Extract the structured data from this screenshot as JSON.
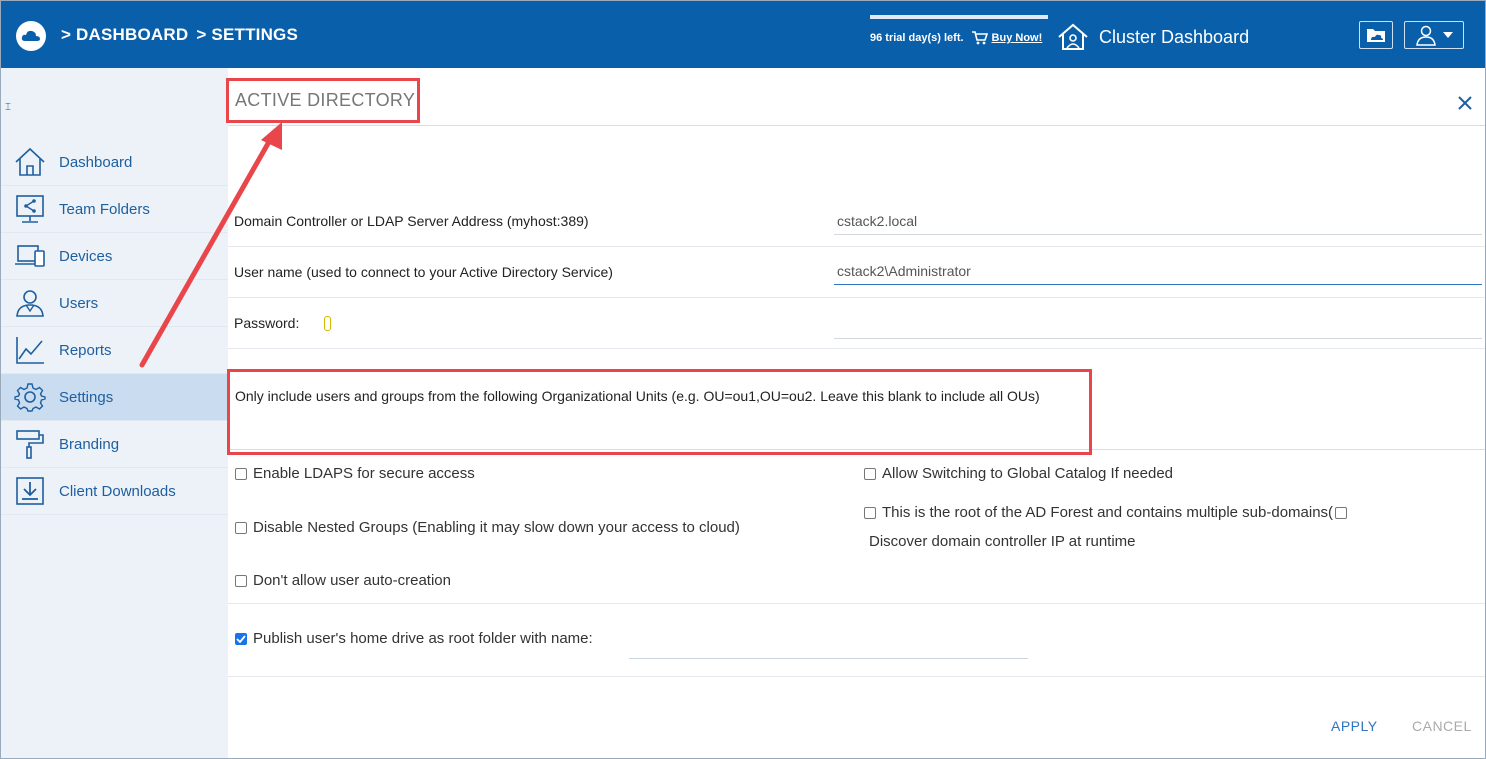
{
  "header": {
    "breadcrumbs": [
      "> DASHBOARD",
      "> SETTINGS"
    ],
    "trial_text": "96 trial day(s) left.",
    "buy_label": "Buy Now!",
    "cluster_label": "Cluster Dashboard",
    "icons": [
      "cloud-logo-icon",
      "cart-icon",
      "cluster-home-icon",
      "folder-icon",
      "user-icon",
      "caret-down-icon"
    ]
  },
  "sidebar": {
    "collapse_glyph": "⌶",
    "items": [
      {
        "label": "Dashboard",
        "icon": "home-icon",
        "active": false
      },
      {
        "label": "Team Folders",
        "icon": "team-folder-icon",
        "active": false
      },
      {
        "label": "Devices",
        "icon": "devices-icon",
        "active": false
      },
      {
        "label": "Users",
        "icon": "users-icon",
        "active": false
      },
      {
        "label": "Reports",
        "icon": "reports-icon",
        "active": false
      },
      {
        "label": "Settings",
        "icon": "gear-icon",
        "active": true
      },
      {
        "label": "Branding",
        "icon": "paint-roller-icon",
        "active": false
      },
      {
        "label": "Client Downloads",
        "icon": "download-icon",
        "active": false
      }
    ]
  },
  "panel": {
    "title": "ACTIVE DIRECTORY",
    "fields": {
      "server_label": "Domain Controller or LDAP Server Address (myhost:389)",
      "server_value": "cstack2.local",
      "username_label": "User name (used to connect to your Active Directory Service)",
      "username_value": "cstack2\\Administrator",
      "password_label": "Password:",
      "password_value": "",
      "ou_label": "Only include users and groups from the following Organizational Units (e.g. OU=ou1,OU=ou2. Leave this blank to include all OUs)"
    },
    "options": {
      "ldaps": {
        "label": "Enable LDAPS for secure access",
        "checked": false
      },
      "global_catalog": {
        "label": "Allow Switching to Global Catalog If needed",
        "checked": false
      },
      "nested_groups": {
        "label": "Disable Nested Groups (Enabling it may slow down your access to cloud)",
        "checked": false
      },
      "ad_forest": {
        "label": "This is the root of the AD Forest and contains multiple sub-domains(",
        "checked": false
      },
      "discover_dc": {
        "label": "Discover domain controller IP at runtime",
        "checked": false
      },
      "auto_create": {
        "label": "Don't allow user auto-creation",
        "checked": false
      },
      "home_drive": {
        "label": "Publish user's home drive as root folder with name:",
        "checked": true,
        "value": ""
      }
    },
    "buttons": {
      "apply": "APPLY",
      "cancel": "CANCEL"
    }
  },
  "colors": {
    "brand": "#0a5fab",
    "annotation": "#e8464b",
    "active_nav": "#c9dcf0"
  }
}
